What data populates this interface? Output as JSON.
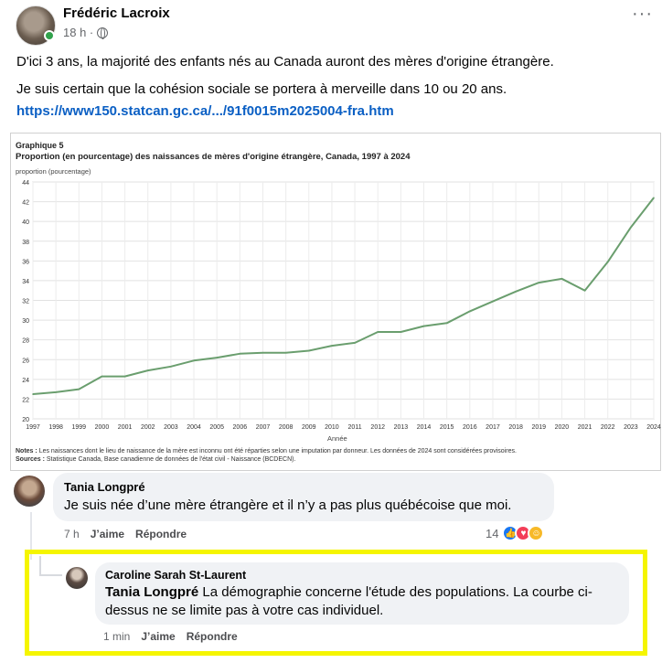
{
  "post": {
    "author": "Frédéric Lacroix",
    "time": "18 h ·",
    "text_line1": "D'ici 3 ans, la majorité des enfants nés au Canada auront des mères d'origine étrangère.",
    "text_line2": "Je suis certain que la cohésion sociale se portera à merveille dans 10 ou 20 ans.",
    "link": "https://www150.statcan.gc.ca/.../91f0015m2025004-fra.htm",
    "more_icon": "ellipsis-icon"
  },
  "chart_data": {
    "type": "line",
    "label": "Graphique 5",
    "title": "Proportion (en pourcentage) des naissances de mères d'origine étrangère, Canada, 1997 à 2024",
    "ylabel": "proportion (pourcentage)",
    "xlabel": "Année",
    "ylim": [
      20,
      44
    ],
    "yticks": [
      20,
      22,
      24,
      26,
      28,
      30,
      32,
      34,
      36,
      38,
      40,
      42,
      44
    ],
    "grid": true,
    "line_color": "#6a9e6e",
    "x": [
      1997,
      1998,
      1999,
      2000,
      2001,
      2002,
      2003,
      2004,
      2005,
      2006,
      2007,
      2008,
      2009,
      2010,
      2011,
      2012,
      2013,
      2014,
      2015,
      2016,
      2017,
      2018,
      2019,
      2020,
      2021,
      2022,
      2023,
      2024
    ],
    "y": [
      22.5,
      22.7,
      23.0,
      24.3,
      24.3,
      24.9,
      25.3,
      25.9,
      26.2,
      26.6,
      26.7,
      26.7,
      26.9,
      27.4,
      27.7,
      28.8,
      28.8,
      29.4,
      29.7,
      30.9,
      31.9,
      32.9,
      33.8,
      34.2,
      33.0,
      35.9,
      39.4,
      42.4
    ],
    "notes_label": "Notes :",
    "notes": "Les naissances dont le lieu de naissance de la mère est inconnu ont été réparties selon une imputation par donneur. Les données de 2024 sont considérées provisoires.",
    "sources_label": "Sources :",
    "sources": "Statistique Canada, Base canadienne de données de l'état civil - Naissance (BCDECN)."
  },
  "comment1": {
    "author": "Tania Longpré",
    "text": "Je suis née d’une mère étrangère et il n’y a pas plus québécoise que moi.",
    "time": "7 h",
    "like": "J’aime",
    "reply": "Répondre",
    "reaction_count": "14"
  },
  "reply": {
    "author": "Caroline Sarah St-Laurent",
    "mention": "Tania Longpré",
    "text": "La démographie concerne l'étude des populations. La courbe ci-dessus ne se limite pas à votre cas individuel.",
    "time": "1 min",
    "like": "J’aime",
    "reply": "Répondre"
  },
  "colors": {
    "highlight": "#f5f500",
    "link": "#0a5fc4",
    "bubble": "#f0f2f5"
  }
}
